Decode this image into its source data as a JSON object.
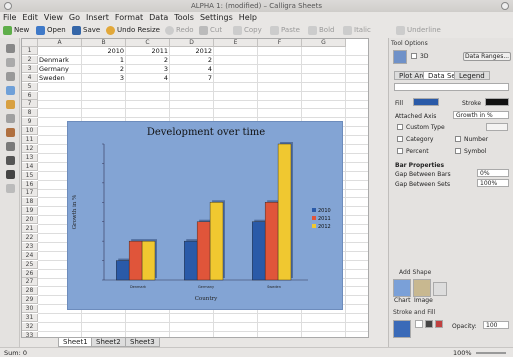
{
  "window": {
    "title": "ALPHA 1:  (modified) – Calligra Sheets"
  },
  "menu": [
    "File",
    "Edit",
    "View",
    "Go",
    "Insert",
    "Format",
    "Data",
    "Tools",
    "Settings",
    "Help"
  ],
  "toolbar": {
    "new": "New",
    "open": "Open",
    "save": "Save",
    "undo": "Undo Resize",
    "redo": "Redo",
    "cut": "Cut",
    "copy": "Copy",
    "paste": "Paste",
    "bold": "Bold",
    "italic": "Italic",
    "underline": "Underline"
  },
  "sheet": {
    "columns": [
      "A",
      "B",
      "C",
      "D",
      "E",
      "F",
      "G"
    ],
    "rows": [
      "1",
      "2",
      "3",
      "4",
      "5",
      "6",
      "7",
      "8",
      "9",
      "10",
      "11",
      "12",
      "13",
      "14",
      "15",
      "16",
      "17",
      "18",
      "19",
      "20",
      "21",
      "22",
      "23",
      "24",
      "25",
      "26",
      "27",
      "28",
      "29",
      "30",
      "31",
      "32",
      "33"
    ],
    "headers": [
      "2010",
      "2011",
      "2012"
    ],
    "data": [
      {
        "label": "Denmark",
        "v": [
          "1",
          "2",
          "2"
        ]
      },
      {
        "label": "Germany",
        "v": [
          "2",
          "3",
          "4"
        ]
      },
      {
        "label": "Sweden",
        "v": [
          "3",
          "4",
          "7"
        ]
      }
    ],
    "tabs": [
      "Sheet1",
      "Sheet2",
      "Sheet3"
    ]
  },
  "chart_data": {
    "type": "bar",
    "title": "Development over time",
    "xlabel": "Country",
    "ylabel": "Growth in %",
    "categories": [
      "Denmark",
      "Germany",
      "Sweden"
    ],
    "series": [
      {
        "name": "2010",
        "values": [
          1,
          2,
          3
        ],
        "color": "#2a5aa8"
      },
      {
        "name": "2011",
        "values": [
          2,
          3,
          4
        ],
        "color": "#e0553a"
      },
      {
        "name": "2012",
        "values": [
          2,
          4,
          7
        ],
        "color": "#f0c830"
      }
    ],
    "ylim": [
      0,
      7
    ],
    "legend": "right",
    "background": "#83a4d4"
  },
  "panel": {
    "title": "Tool Options",
    "check3d": "3D",
    "dataRanges": "Data Ranges...",
    "tabs": [
      "Plot Area",
      "Data Sets",
      "Legend"
    ],
    "fill": "Fill",
    "stroke": "Stroke",
    "attachedAxis": "Attached Axis",
    "attachedAxisValue": "Growth in %",
    "customType": "Custom Type",
    "category": "Category",
    "number": "Number",
    "percent": "Percent",
    "symbol": "Symbol",
    "barProps": "Bar Properties",
    "gapBars": "Gap Between Bars",
    "gapBarsVal": "0%",
    "gapSets": "Gap Between Sets",
    "gapSetsVal": "100%",
    "addShape": "Add Shape",
    "chartShape": "Chart",
    "imageShape": "Image",
    "strokeFill": "Stroke and Fill",
    "opacity": "Opacity:",
    "opacityVal": "100"
  },
  "status": {
    "sum": "Sum: 0",
    "zoom": "100%"
  }
}
